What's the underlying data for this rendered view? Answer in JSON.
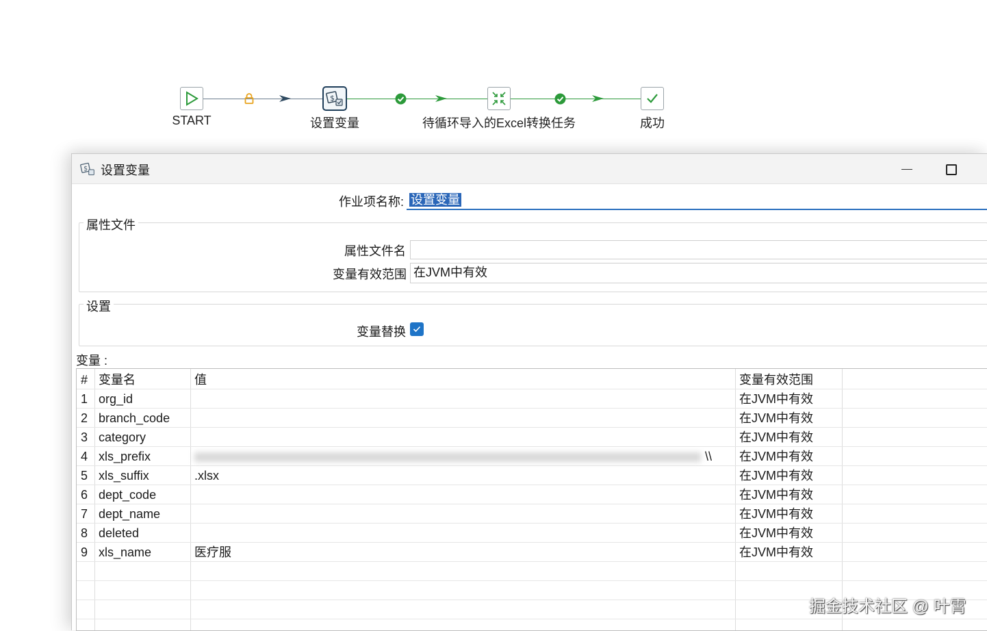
{
  "workflow": {
    "nodes": [
      {
        "label": "START",
        "icon": "play-icon"
      },
      {
        "label": "设置变量",
        "icon": "set-variables-icon"
      },
      {
        "label": "待循环导入的Excel转换任务",
        "icon": "transformation-icon"
      },
      {
        "label": "成功",
        "icon": "success-icon"
      }
    ],
    "hops": [
      {
        "type": "unconditional",
        "icon": "lock-icon",
        "color": "#e8a21d"
      },
      {
        "type": "success",
        "icon": "check-circle-icon",
        "color": "#2c9a3a"
      },
      {
        "type": "success",
        "icon": "check-circle-icon",
        "color": "#2c9a3a"
      }
    ]
  },
  "dialog": {
    "title": "设置变量",
    "job_entry_label": "作业项名称:",
    "job_entry_value": "设置变量",
    "properties_group": "属性文件",
    "property_file_label": "属性文件名",
    "property_file_value": "",
    "scope_label": "变量有效范围",
    "scope_value": "在JVM中有效",
    "settings_group": "设置",
    "replace_label": "变量替换",
    "replace_checked": true,
    "variables_label": "变量 :",
    "table": {
      "headers": [
        "#",
        "变量名",
        "值",
        "变量有效范围"
      ],
      "rows": [
        [
          "1",
          "org_id",
          "",
          "在JVM中有效"
        ],
        [
          "2",
          "branch_code",
          "",
          "在JVM中有效"
        ],
        [
          "3",
          "category",
          "",
          "在JVM中有效"
        ],
        [
          "4",
          "xls_prefix",
          "\\\\",
          "在JVM中有效"
        ],
        [
          "5",
          "xls_suffix",
          ".xlsx",
          "在JVM中有效"
        ],
        [
          "6",
          "dept_code",
          "",
          "在JVM中有效"
        ],
        [
          "7",
          "dept_name",
          "",
          "在JVM中有效"
        ],
        [
          "8",
          "deleted",
          "",
          "在JVM中有效"
        ],
        [
          "9",
          "xls_name",
          "医疗服",
          "在JVM中有效"
        ]
      ]
    }
  },
  "watermark": "掘金技术社区 @ 叶霄",
  "colors": {
    "accent": "#1e74c7",
    "success": "#2c9a3a",
    "lock": "#e8a21d"
  }
}
